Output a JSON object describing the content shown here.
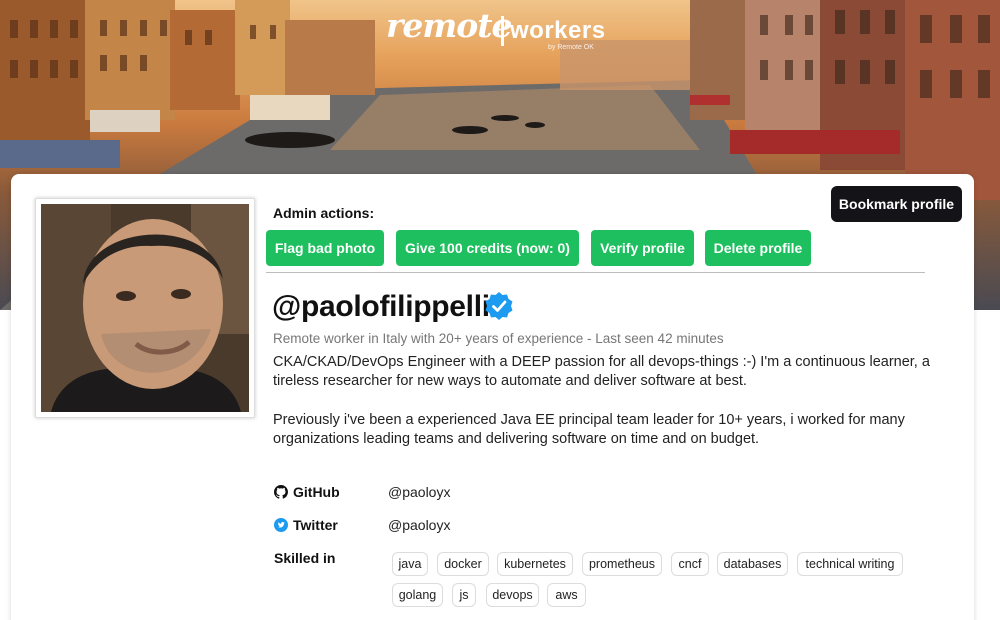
{
  "brand": {
    "name_left": "remote",
    "name_right": "workers",
    "by": "by Remote OK"
  },
  "actions": {
    "bookmark": "Bookmark profile",
    "admin_label": "Admin actions:",
    "admin_buttons": [
      "Flag bad photo",
      "Give 100 credits (now: 0)",
      "Verify profile",
      "Delete profile"
    ]
  },
  "profile": {
    "username": "@paolofilippelli",
    "verified": true,
    "subline": "Remote worker in Italy with 20+ years of experience - Last seen 42 minutes",
    "bio": [
      "CKA/CKAD/DevOps Engineer with a DEEP passion for all devops-things :-) I'm a continuous learner, a tireless researcher for new ways to automate and deliver software at best.",
      "Previously i've been a experienced Java EE principal team leader for 10+ years, i worked for many organizations leading teams and delivering software on time and on budget."
    ],
    "links": [
      {
        "label": "GitHub",
        "value": "@paoloyx",
        "icon": "github-icon"
      },
      {
        "label": "Twitter",
        "value": "@paoloyx",
        "icon": "twitter-icon"
      }
    ],
    "skills_label": "Skilled in",
    "skills": [
      "java",
      "docker",
      "kubernetes",
      "prometheus",
      "cncf",
      "databases",
      "technical writing",
      "golang",
      "js",
      "devops",
      "aws"
    ]
  },
  "colors": {
    "admin_green": "#1dbf5e",
    "bookmark_dark": "#141418",
    "verified_blue": "#1d9bf0"
  }
}
